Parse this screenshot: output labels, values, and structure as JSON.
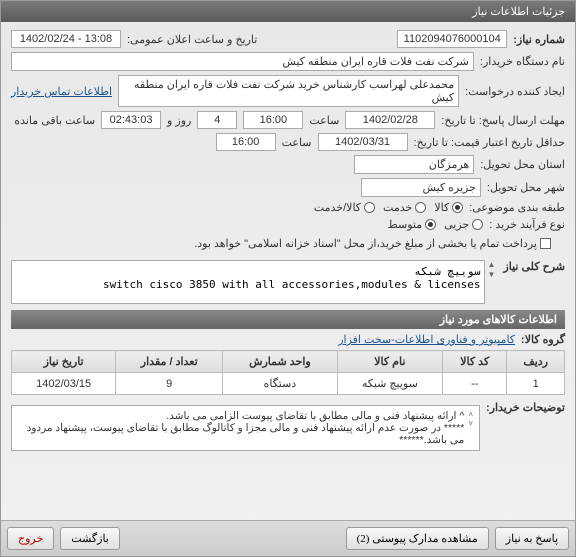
{
  "window": {
    "title": "جزئیات اطلاعات نیاز"
  },
  "labels": {
    "req_no": "شماره نیاز:",
    "announce": "تاریخ و ساعت اعلان عمومی:",
    "buyer_name": "نام دستگاه خریدار:",
    "req_creator": "ایجاد کننده درخواست:",
    "contact_link": "اطلاعات تماس خریدار",
    "deadline_sendto": "مهلت ارسال پاسخ: تا تاریخ:",
    "hour": "ساعت",
    "day_and": "روز و",
    "hours_left": "ساعت باقی مانده",
    "deadlineto": "حداقل تاریخ اعتبار قیمت: تا تاریخ:",
    "req_loc": "استان محل تحویل:",
    "city_loc": "شهر محل تحویل:",
    "category": "طبقه بندی موضوعی:",
    "goods": "کالا",
    "service": "خدمت",
    "goods_service": "کالا/خدمت",
    "purchase_type": "نوع فرآیند خرید :",
    "small": "جزیی",
    "medium": "متوسط",
    "pay_note": "پرداخت تمام یا بخشی از مبلغ خرید،از محل \"اسناد خزانه اسلامی\" خواهد بود.",
    "desc_title": "شرح کلی نیاز",
    "items_title": "اطلاعات کالاهای مورد نیاز",
    "group": "گروه کالا:",
    "buyer_desc_label": "توضیحات خریدار:"
  },
  "values": {
    "req_no": "1102094076000104",
    "announce": "1402/02/24 - 13:08",
    "buyer_name": "شرکت نفت فلات قاره ایران منطقه کیش",
    "req_creator": "محمدعلی لهراسب کارشناس خرید شرکت نفت فلات قاره ایران منطقه کیش",
    "deadline_date": "1402/02/28",
    "deadline_time": "16:00",
    "days_left": "4",
    "hours_left": "02:43:03",
    "validity_date": "1402/03/31",
    "validity_time": "16:00",
    "province": "هرمزگان",
    "city": "جزیره کیش",
    "desc": "سوییچ شبکه\nswitch cisco 3850 with all accessories,modules & licenses",
    "group": "کامپیوتر و فناوری اطلاعات-سخت افزار",
    "buyer_note": "^ ارائه پیشنهاد فنی و مالی مطابق با تقاضای پیوست الزامی می باشد.\n***** در صورت عدم ارائه پیشنهاد فنی و مالی مجزا و کاتالوگ مطابق با تقاضای پیوست، پیشنهاد مردود می باشد.******"
  },
  "table": {
    "headers": {
      "row": "ردیف",
      "code": "کد کالا",
      "name": "نام کالا",
      "unit": "واحد شمارش",
      "qty": "تعداد / مقدار",
      "date": "تاریخ نیاز"
    },
    "rows": [
      {
        "row": "1",
        "code": "--",
        "name": "سوییچ شبکه",
        "unit": "دستگاه",
        "qty": "9",
        "date": "1402/03/15"
      }
    ]
  },
  "buttons": {
    "respond": "پاسخ به نیاز",
    "attachments": "مشاهده مدارک پیوستی (2)",
    "back": "بازگشت",
    "exit": "خروج"
  }
}
